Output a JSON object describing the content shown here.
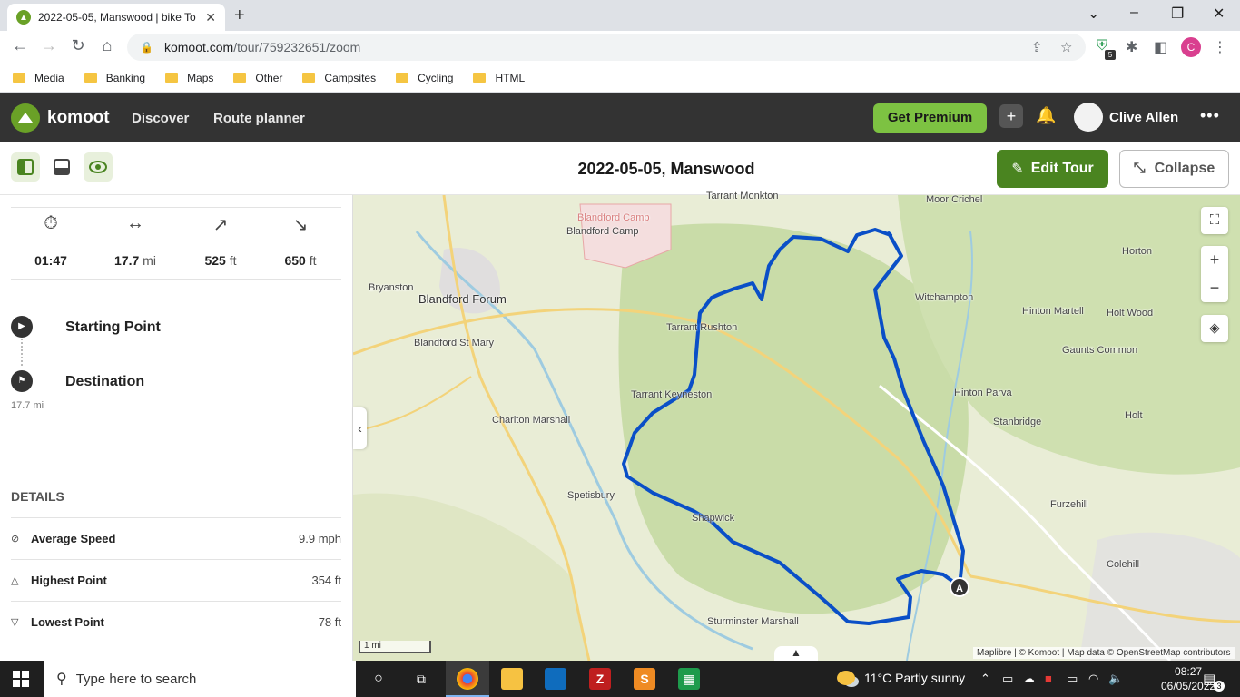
{
  "browser": {
    "tab_title": "2022-05-05, Manswood | bike To",
    "tab_close": "✕",
    "new_tab": "+",
    "url_host": "komoot.com",
    "url_path": "/tour/759232651/zoom",
    "ext_badge": "5",
    "profile_initial": "C",
    "bookmarks": [
      "Media",
      "Banking",
      "Maps",
      "Other",
      "Campsites",
      "Cycling",
      "HTML"
    ]
  },
  "komoot": {
    "brand": "komoot",
    "nav": [
      "Discover",
      "Route planner"
    ],
    "premium_label": "Get Premium",
    "user_name": "Clive Allen",
    "accent": "#7dc242"
  },
  "tour": {
    "title": "2022-05-05, Manswood",
    "edit_label": "Edit Tour",
    "collapse_label": "Collapse",
    "stats": [
      {
        "icon": "stopwatch-icon",
        "value": "01:47",
        "unit": ""
      },
      {
        "icon": "distance-arrows-icon",
        "value": "17.7",
        "unit": "mi"
      },
      {
        "icon": "uphill-arrow-icon",
        "value": "525",
        "unit": "ft"
      },
      {
        "icon": "downhill-arrow-icon",
        "value": "650",
        "unit": "ft"
      }
    ],
    "waypoints": [
      {
        "label": "Starting Point"
      },
      {
        "label": "Destination",
        "distance": "17.7 mi"
      }
    ],
    "details_heading": "DETAILS",
    "details": [
      {
        "label": "Average Speed",
        "value": "9.9 mph"
      },
      {
        "label": "Highest Point",
        "value": "354 ft"
      },
      {
        "label": "Lowest Point",
        "value": "78 ft"
      }
    ]
  },
  "map": {
    "places": [
      "Tarrant Monkton",
      "Moor Crichel",
      "Blandford Camp",
      "Blandford Camp",
      "Horton",
      "Bryanston",
      "Blandford Forum",
      "Witchampton",
      "Hinton Martell",
      "Holt Wood",
      "Tarrant Rushton",
      "Blandford St Mary",
      "Gaunts Common",
      "Tarrant Keyneston",
      "Hinton Parva",
      "Charlton Marshall",
      "Stanbridge",
      "Holt",
      "Spetisbury",
      "Furzehill",
      "Shapwick",
      "Colehill",
      "Sturminster Marshall"
    ],
    "start_marker": "A",
    "scale_label": "1 mi",
    "attribution": "Maplibre | © Komoot | Map data © OpenStreetMap contributors",
    "route_color": "#0a4fc7"
  },
  "taskbar": {
    "search_placeholder": "Type here to search",
    "weather": "11°C  Partly sunny",
    "time": "08:27",
    "date": "06/05/2022",
    "notifications": "3"
  }
}
